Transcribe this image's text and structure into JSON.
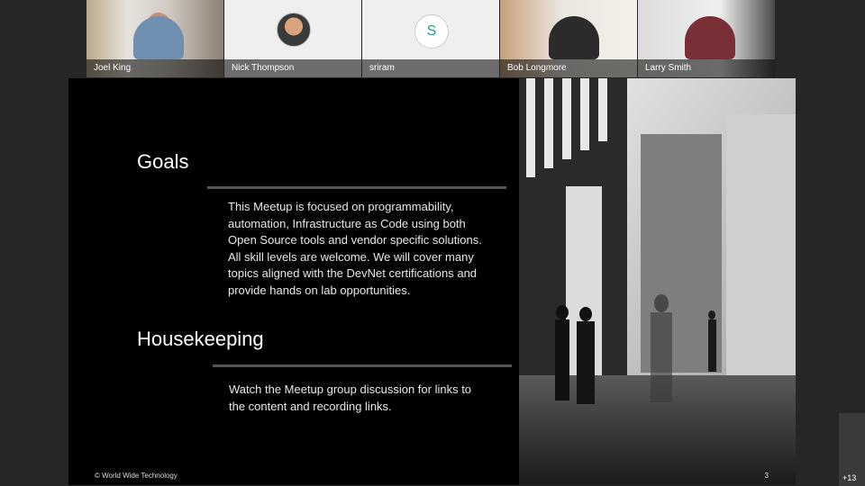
{
  "participants": [
    {
      "name": "Joel King",
      "kind": "video"
    },
    {
      "name": "Nick Thompson",
      "kind": "photo-avatar"
    },
    {
      "name": "sriram",
      "kind": "letter-avatar",
      "initial": "S"
    },
    {
      "name": "Bob Longmore",
      "kind": "video"
    },
    {
      "name": "Larry Smith",
      "kind": "video"
    }
  ],
  "slide": {
    "sections": [
      {
        "heading": "Goals",
        "lines": [
          "This Meetup is focused on programmability,",
          "automation, Infrastructure as Code using both",
          "Open Source tools and vendor specific solutions.",
          "All skill levels are welcome. We will cover many",
          "topics aligned with the DevNet certifications and",
          "provide hands on lab opportunities."
        ]
      },
      {
        "heading": "Housekeeping",
        "lines": [
          "Watch the Meetup group discussion for links to",
          "the content and recording links."
        ]
      }
    ],
    "footer": "© World Wide Technology",
    "page_number": "3"
  },
  "overflow_count": "+13",
  "colors": {
    "background": "#262626",
    "slide": "#000000",
    "accent_letter": "#1a9e8e"
  }
}
